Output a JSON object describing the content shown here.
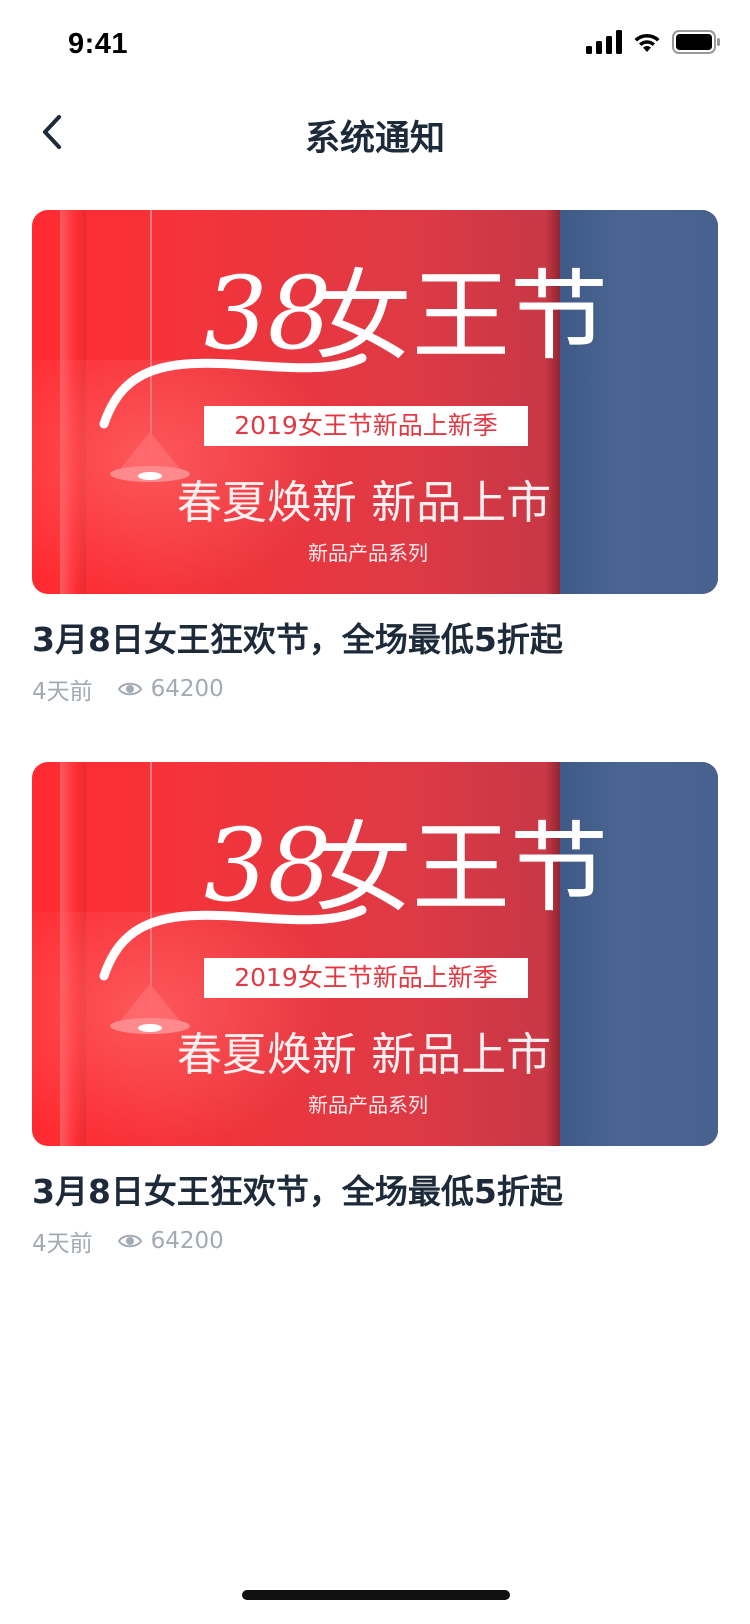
{
  "status_bar": {
    "time": "9:41"
  },
  "nav": {
    "title": "系统通知"
  },
  "posts": [
    {
      "banner": {
        "big_number": "38",
        "big_text": "女王节",
        "badge": "2019女王节新品上新季",
        "headline": "春夏焕新 新品上市",
        "subline": "新品产品系列"
      },
      "title": "3月8日女王狂欢节，全场最低5折起",
      "time": "4天前",
      "views": "64200"
    },
    {
      "banner": {
        "big_number": "38",
        "big_text": "女王节",
        "badge": "2019女王节新品上新季",
        "headline": "春夏焕新 新品上市",
        "subline": "新品产品系列"
      },
      "title": "3月8日女王狂欢节，全场最低5折起",
      "time": "4天前",
      "views": "64200"
    }
  ],
  "colors": {
    "banner_red": "#e23a44",
    "banner_blue": "#4a6592",
    "text_dark": "#1d2a3a",
    "text_muted": "#a4aab3"
  },
  "icons": [
    "signal-icon",
    "wifi-icon",
    "battery-icon",
    "back-chevron-icon",
    "eye-icon"
  ]
}
